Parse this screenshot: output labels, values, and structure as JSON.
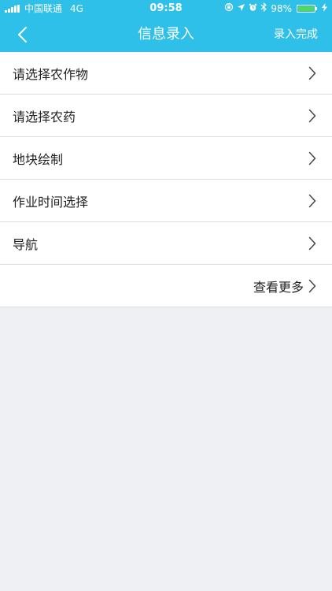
{
  "status": {
    "carrier": "中国联通",
    "network": "4G",
    "time": "09:58",
    "battery": "98%",
    "battery_level": 98
  },
  "nav": {
    "title": "信息录入",
    "action": "录入完成",
    "back_icon": "chevron-left-icon"
  },
  "list": {
    "items": [
      {
        "label": "请选择农作物"
      },
      {
        "label": "请选择农药"
      },
      {
        "label": "地块绘制"
      },
      {
        "label": "作业时间选择"
      },
      {
        "label": "导航"
      }
    ],
    "more": "查看更多"
  },
  "colors": {
    "header": "#2ec0e8",
    "background": "#eef0f3",
    "battery": "#4cd964"
  }
}
